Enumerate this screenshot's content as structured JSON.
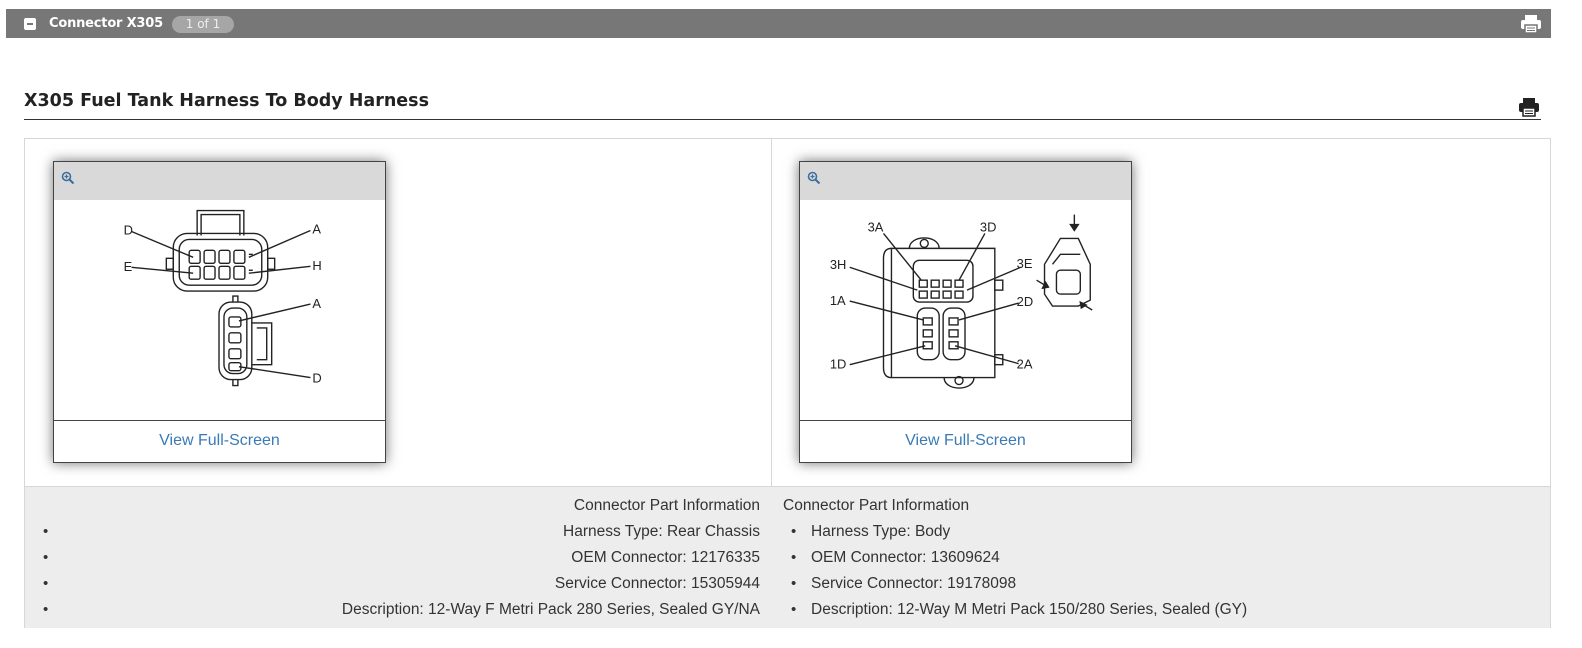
{
  "header": {
    "title": "Connector X305",
    "count": "1 of 1"
  },
  "section": {
    "title": "X305 Fuel Tank Harness To Body Harness"
  },
  "connectors": [
    {
      "view_label": "View Full-Screen",
      "pin_labels": [
        "D",
        "A",
        "E",
        "H",
        "A",
        "D"
      ],
      "info_heading": "Connector Part Information",
      "info": [
        "Harness Type: Rear Chassis",
        "OEM Connector: 12176335",
        "Service Connector: 15305944",
        "Description: 12-Way F Metri Pack 280 Series, Sealed GY/NA"
      ]
    },
    {
      "view_label": "View Full-Screen",
      "pin_labels": [
        "3A",
        "3D",
        "3H",
        "3E",
        "1A",
        "2D",
        "1D",
        "2A"
      ],
      "info_heading": "Connector Part Information",
      "info": [
        "Harness Type: Body",
        "OEM Connector: 13609624",
        "Service Connector: 19178098",
        "Description: 12-Way M Metri Pack 150/280 Series, Sealed (GY)"
      ]
    }
  ],
  "colors": {
    "header_bar": "#777777",
    "link": "#3a7ab5",
    "info_background": "#ededee"
  },
  "icons": [
    "collapse-icon",
    "print-icon",
    "zoom-in-icon"
  ]
}
